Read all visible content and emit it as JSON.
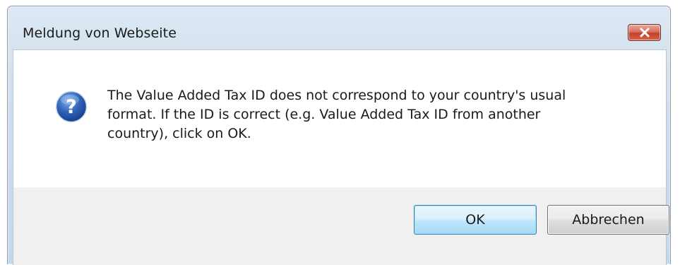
{
  "dialog": {
    "title": "Meldung von Webseite",
    "close_icon": "close-icon",
    "message_icon": "question-icon",
    "message": "The Value Added Tax ID does not correspond to your country's usual\nformat. If the ID is correct (e.g. Value Added Tax ID from another\ncountry), click on OK.",
    "buttons": {
      "ok_label": "OK",
      "cancel_label": "Abbrechen"
    }
  },
  "colors": {
    "titlebar": "#cfdeec",
    "close_button": "#c2412c",
    "ok_button_border": "#3c7fb1",
    "question_icon": "#2b5fb0",
    "footer": "#f0f0f0"
  }
}
